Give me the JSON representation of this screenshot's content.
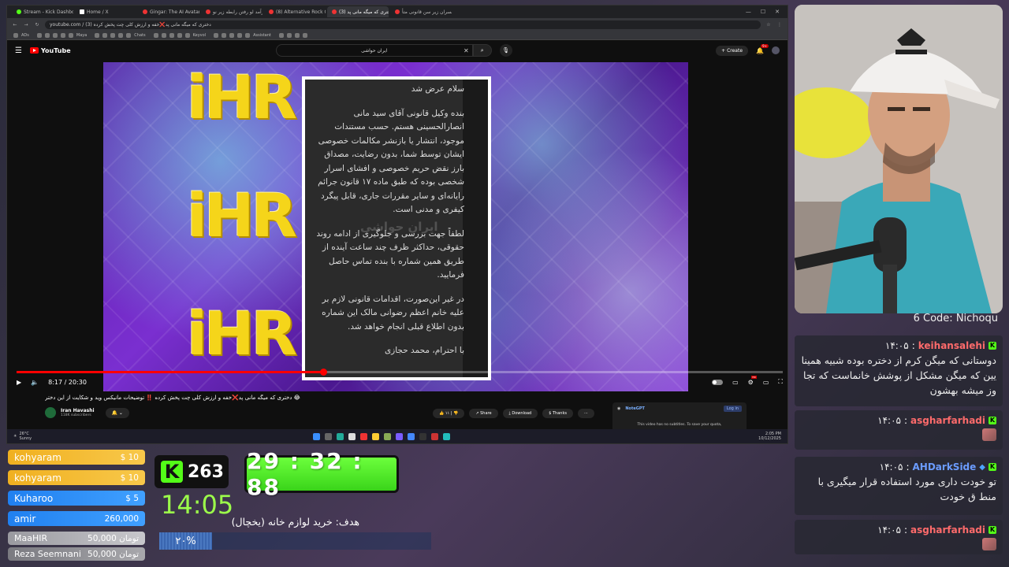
{
  "browser": {
    "tabs": [
      {
        "label": "Stream - Kick Dashboard",
        "fav": "k"
      },
      {
        "label": "Home / X",
        "fav": "x"
      },
      {
        "label": "Gingar: The AI Avatar Generato",
        "fav": "r"
      },
      {
        "label": "از درآمد لو رفتن رابطه زیر نو",
        "fav": "r"
      },
      {
        "label": "(8) Alternative Rock Of The 2",
        "fav": "r"
      },
      {
        "label": "(3) دختری که میگه مانی پد",
        "fav": "r",
        "active": true
      },
      {
        "label": "اگر پسران زیر سن قانونی متأ",
        "fav": "r"
      }
    ],
    "url": "youtube.com / (3) دختری که میگه مانی پد❌خفه و ارزش کلی چت پخش کرده",
    "bookmarks": [
      "ADs",
      "Maya",
      "Chats",
      "Keyvol",
      "Assistant"
    ]
  },
  "youtube": {
    "logo": "YouTube",
    "search_value": "ایران حواشی",
    "create_label": "Create",
    "notif_count": "9+"
  },
  "letter": {
    "paragraphs": [
      "سلام عرض شد",
      "بنده وکیل قانونی آقای سید مانی انصارالحسینی هستم. حسب مستندات موجود، انتشار یا بازنشر مکالمات خصوصی ایشان توسط شما، بدون رضایت، مصداق بارز نقض حریم خصوصی و افشای اسرار شخصی بوده که طبق ماده ۱۷ قانون جرائم رایانه‌ای و سایر مقررات جاری، قابل پیگرد کیفری و مدنی است.",
      "لطفاً جهت بررسی و جلوگیری از ادامه روند حقوقی، حداکثر ظرف چند ساعت آینده از طریق همین شماره با بنده تماس حاصل فرمایید.",
      "در غیر این‌صورت، اقدامات قانونی لازم بر علیه خانم اعظم رضوانی مالک این شماره بدون اطلاع قبلی انجام خواهد شد.",
      "با احترام، محمد حجازی"
    ],
    "watermark": "ایران حواشی"
  },
  "player": {
    "time": "8:17 / 20:30",
    "progress": 0.4
  },
  "video": {
    "title": "😂 دختری که میگه مانی پد❌خفه و ارزش کلی چت پخش کرده ‼️ توضیحات مانیکس وید و شکایت از این دختر",
    "channel": "Iran Havashi",
    "subs": "118K subscribers",
    "likes": "۱۱",
    "share": "Share",
    "download": "Download",
    "thanks": "Thanks"
  },
  "notegpt": {
    "title": "NoteGPT",
    "login": "Log in",
    "message": "This video has no subtitles. To save your quota,"
  },
  "taskbar": {
    "weather_temp": "26°C",
    "weather_desc": "Sunny",
    "time": "2:05 PM",
    "date": "10/12/2025"
  },
  "chat": {
    "code_line": "6 Code: Nichoqu",
    "messages": [
      {
        "user": "keihansalehi",
        "time": "۱۴:۰۵",
        "text": "دوستانی که میگن کرم از دختره بوده شبیه همینا یین که میگن مشکل از پوشش خانماست که تجا وز میشه بهشون"
      },
      {
        "user": "asgharfarhadi",
        "time": "۱۴:۰۵",
        "text": ""
      },
      {
        "user": "AHDarkSide",
        "time": "۱۴:۰۵",
        "text": "تو خودت داری مورد استفاده قرار میگیری با منط ق خودت"
      },
      {
        "user": "asgharfarhadi",
        "time": "۱۴:۰۵",
        "text": ""
      }
    ]
  },
  "donors": [
    {
      "name": "kohyaram",
      "amount": "$ 10",
      "style": "gold"
    },
    {
      "name": "kohyaram",
      "amount": "$ 10",
      "style": "gold"
    },
    {
      "name": "Kuharoo",
      "amount": "$ 5",
      "style": "blue"
    },
    {
      "name": "amir",
      "amount": "260,000",
      "style": "blue"
    },
    {
      "name": "MaaHIR",
      "amount": "50,000 تومان",
      "style": "grey"
    },
    {
      "name": "Reza Seemnani",
      "amount": "50,000 تومان",
      "style": "grey2"
    }
  ],
  "stream": {
    "viewers": "263",
    "clock": "14:05",
    "timer": "29 : 32 : 88",
    "goal_label": "هدف: خرید لوازم خانه (یخچال)",
    "goal_percent": "۲۰%",
    "goal_fraction": 0.195
  },
  "colors": {
    "kick_green": "#53fc18",
    "yt_red": "#ff0000",
    "chat_red": "#ff6b6b"
  }
}
